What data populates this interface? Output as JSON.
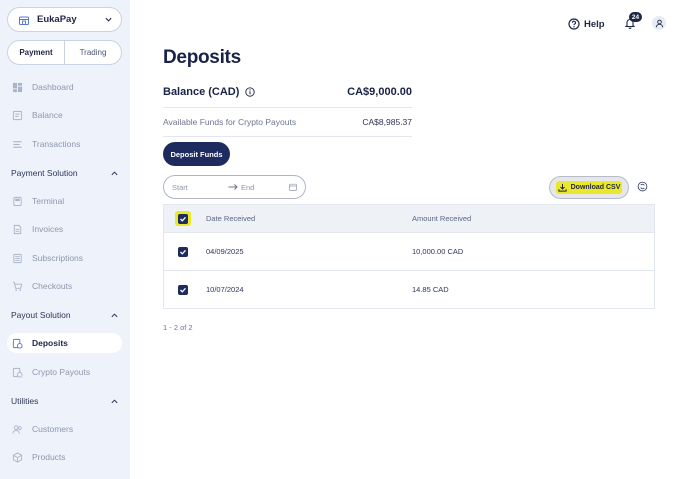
{
  "sidebar": {
    "org_name": "EukaPay",
    "tabs": [
      {
        "label": "Payment",
        "active": true
      },
      {
        "label": "Trading",
        "active": false
      }
    ],
    "items": {
      "dashboard": "Dashboard",
      "balance": "Balance",
      "transactions": "Transactions",
      "terminal": "Terminal",
      "invoices": "Invoices",
      "subscriptions": "Subscriptions",
      "checkouts": "Checkouts",
      "deposits": "Deposits",
      "crypto_payouts": "Crypto Payouts",
      "customers": "Customers",
      "products": "Products"
    },
    "sections": {
      "payment_solution": "Payment Solution",
      "payout_solution": "Payout Solution",
      "utilities": "Utilities"
    },
    "active_item": "Deposits"
  },
  "topbar": {
    "help_label": "Help",
    "notification_count": "24"
  },
  "main": {
    "title": "Deposits",
    "balance_label": "Balance (CAD)",
    "balance_value": "CA$9,000.00",
    "available_label": "Available Funds for Crypto Payouts",
    "available_value": "CA$8,985.37",
    "deposit_button": "Deposit Funds",
    "date_start_placeholder": "Start",
    "date_end_placeholder": "End",
    "download_csv": "Download CSV",
    "table": {
      "columns": [
        "Date Received",
        "Amount Received"
      ],
      "rows": [
        {
          "date": "04/09/2025",
          "amount": "10,000.00 CAD",
          "checked": true
        },
        {
          "date": "10/07/2024",
          "amount": "14.85 CAD",
          "checked": true
        }
      ],
      "header_checked": true
    },
    "pagination": "1 - 2 of 2"
  },
  "colors": {
    "navy": "#1d2b5f",
    "highlight_yellow": "#ebe72b",
    "sidebar_bg": "#eef3fb"
  }
}
